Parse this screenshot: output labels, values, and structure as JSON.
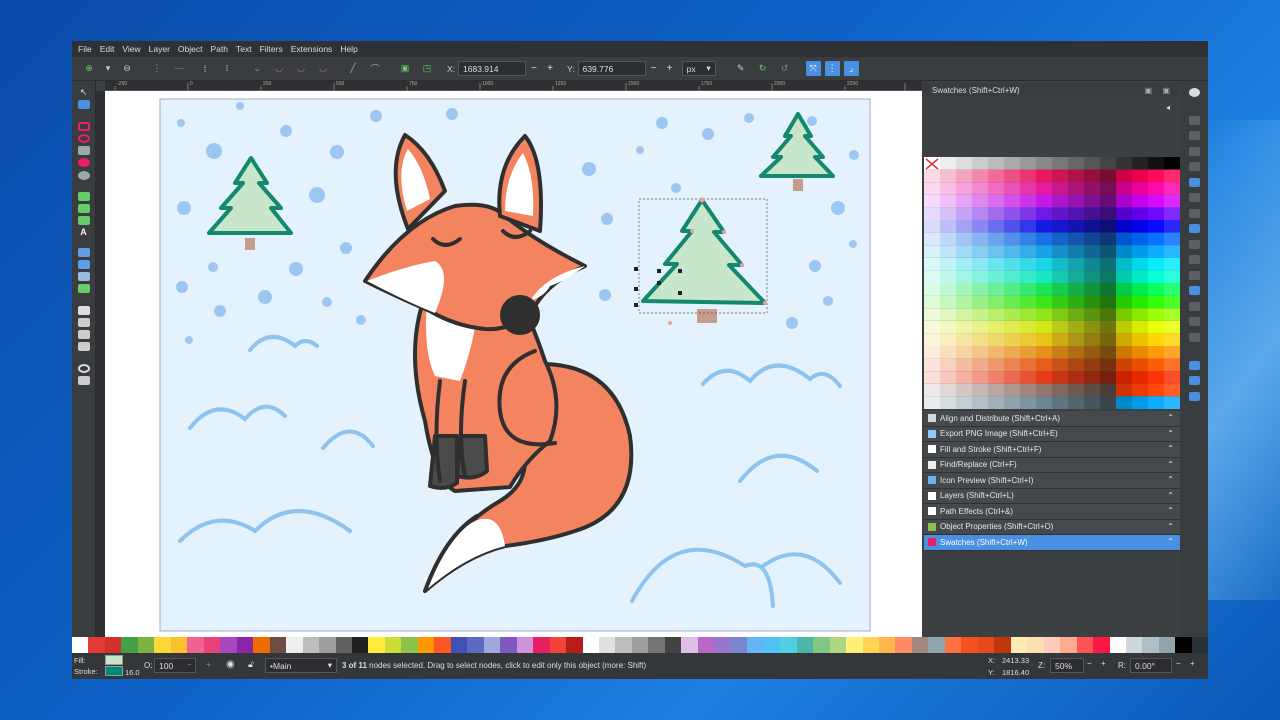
{
  "menu": [
    "File",
    "Edit",
    "View",
    "Layer",
    "Object",
    "Path",
    "Text",
    "Filters",
    "Extensions",
    "Help"
  ],
  "toolbar": {
    "x_label": "X:",
    "x_value": "1683.914",
    "y_label": "Y:",
    "y_value": "639.776",
    "unit": "px",
    "minus": "−",
    "plus": "+"
  },
  "ruler_ticks": [
    "-250",
    "0",
    "250",
    "500",
    "750",
    "1000",
    "1250",
    "1500",
    "1750",
    "2000",
    "2250"
  ],
  "dock": {
    "title": "Swatches (Shift+Ctrl+W)",
    "panels": [
      {
        "label": "Align and Distribute (Shift+Ctrl+A)",
        "color": "#cfd8dc"
      },
      {
        "label": "Export PNG Image (Shift+Ctrl+E)",
        "color": "#90caf9"
      },
      {
        "label": "Fill and Stroke (Shift+Ctrl+F)",
        "color": "#ffffff"
      },
      {
        "label": "Find/Replace (Ctrl+F)",
        "color": "#eeeeee"
      },
      {
        "label": "Icon Preview (Shift+Ctrl+I)",
        "color": "#64b5f6"
      },
      {
        "label": "Layers (Shift+Ctrl+L)",
        "color": "#ffffff"
      },
      {
        "label": "Path Effects (Ctrl+&)",
        "color": "#ffffff"
      },
      {
        "label": "Object Properties (Shift+Ctrl+O)",
        "color": "#8bc34a"
      },
      {
        "label": "Swatches (Shift+Ctrl+W)",
        "color": "#e91e63",
        "active": true
      }
    ]
  },
  "status": {
    "fill_label": "Fill:",
    "stroke_label": "Stroke:",
    "fill_color": "#c8e6c9",
    "stroke_color": "#00897b",
    "stroke_width": "16.0",
    "opacity_label": "O:",
    "opacity_value": "100",
    "layer": "•Main",
    "message_bold": "3 of 11",
    "message": " nodes selected. Drag to select nodes, click to edit only this object (more: Shift)",
    "x_label": "X:",
    "x_value": "2413.33",
    "y_label": "Y:",
    "y_value": "1816.40",
    "zoom_label": "Z:",
    "zoom_value": "50%",
    "rot_label": "R:",
    "rot_value": "0.00°"
  },
  "colors": {
    "accent": "#4a90e2",
    "fox_orange": "#f4845f",
    "tree_fill": "#c8e6c9",
    "tree_stroke": "#14876f",
    "snow_dot": "#9dc7f0",
    "page_bg": "#e3f2fc"
  }
}
